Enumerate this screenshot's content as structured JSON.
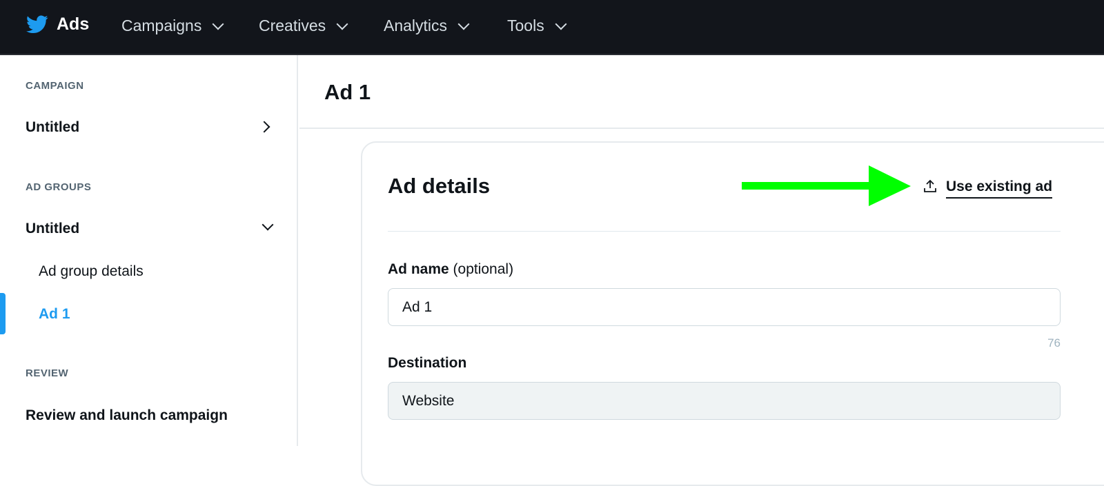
{
  "topbar": {
    "brand": "Ads",
    "menus": [
      "Campaigns",
      "Creatives",
      "Analytics",
      "Tools"
    ]
  },
  "sidebar": {
    "campaign_section": "CAMPAIGN",
    "campaign_name": "Untitled",
    "ad_groups_section": "AD GROUPS",
    "ad_group_name": "Untitled",
    "ad_group_details": "Ad group details",
    "active_ad": "Ad 1",
    "review_section": "REVIEW",
    "review_launch": "Review and launch campaign"
  },
  "main": {
    "title": "Ad 1",
    "card": {
      "title": "Ad details",
      "use_existing": "Use existing ad",
      "ad_name_label": "Ad name",
      "ad_name_optional": "(optional)",
      "ad_name_value": "Ad 1",
      "char_count": "76",
      "destination_label": "Destination",
      "destination_value": "Website"
    }
  },
  "colors": {
    "accent": "#1d9bf0",
    "annotation_arrow": "#00ff00",
    "topbar": "#12151b"
  }
}
